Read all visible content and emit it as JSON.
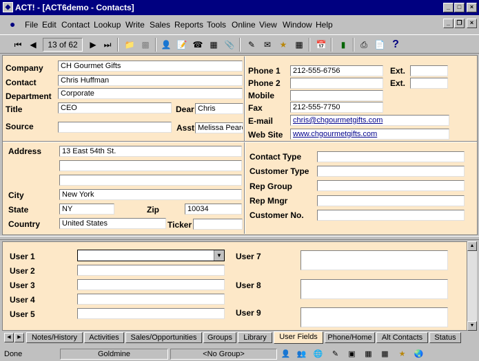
{
  "window": {
    "title": "ACT! - [ACT6demo - Contacts]"
  },
  "menu": [
    "File",
    "Edit",
    "Contact",
    "Lookup",
    "Write",
    "Sales",
    "Reports",
    "Tools",
    "Online",
    "View",
    "Window",
    "Help"
  ],
  "toolbar": {
    "record_position": "13 of 62"
  },
  "contact": {
    "company_label": "Company",
    "company": "CH Gourmet Gifts",
    "contact_label": "Contact",
    "contact": "Chris Huffman",
    "department_label": "Department",
    "department": "Corporate",
    "title_label": "Title",
    "title": "CEO",
    "dear_label": "Dear",
    "dear": "Chris",
    "source_label": "Source",
    "source": "",
    "asst_label": "Asst",
    "asst": "Melissa Pearc",
    "phone1_label": "Phone 1",
    "phone1": "212-555-6756",
    "phone2_label": "Phone 2",
    "phone2": "",
    "ext_label": "Ext.",
    "ext1": "",
    "ext2": "",
    "mobile_label": "Mobile",
    "mobile": "",
    "fax_label": "Fax",
    "fax": "212-555-7750",
    "email_label": "E-mail",
    "email": "chris@chgourmetgifts.com",
    "website_label": "Web Site",
    "website": "www.chgourmetgifts.com",
    "address_label": "Address",
    "address1": "13 East 54th St.",
    "address2": "",
    "address3": "",
    "city_label": "City",
    "city": "New York",
    "state_label": "State",
    "state": "NY",
    "zip_label": "Zip",
    "zip": "10034",
    "country_label": "Country",
    "country": "United States",
    "ticker_label": "Ticker",
    "ticker": "",
    "contact_type_label": "Contact Type",
    "contact_type": "",
    "customer_type_label": "Customer Type",
    "customer_type": "",
    "rep_group_label": "Rep Group",
    "rep_group": "",
    "rep_mngr_label": "Rep Mngr",
    "rep_mngr": "",
    "customer_no_label": "Customer No.",
    "customer_no": ""
  },
  "user_fields": {
    "user1_label": "User 1",
    "user2_label": "User 2",
    "user3_label": "User 3",
    "user4_label": "User 4",
    "user5_label": "User 5",
    "user7_label": "User 7",
    "user8_label": "User 8",
    "user9_label": "User 9"
  },
  "tabs": [
    "Notes/History",
    "Activities",
    "Sales/Opportunities",
    "Groups",
    "Library",
    "User Fields",
    "Phone/Home",
    "Alt Contacts",
    "Status"
  ],
  "active_tab": "User Fields",
  "status": {
    "left": "Done",
    "user": "Goldmine",
    "group": "<No Group>"
  },
  "colors": {
    "form_bg": "#fde8c8",
    "title_bg": "#000080",
    "link": "#00008b"
  }
}
